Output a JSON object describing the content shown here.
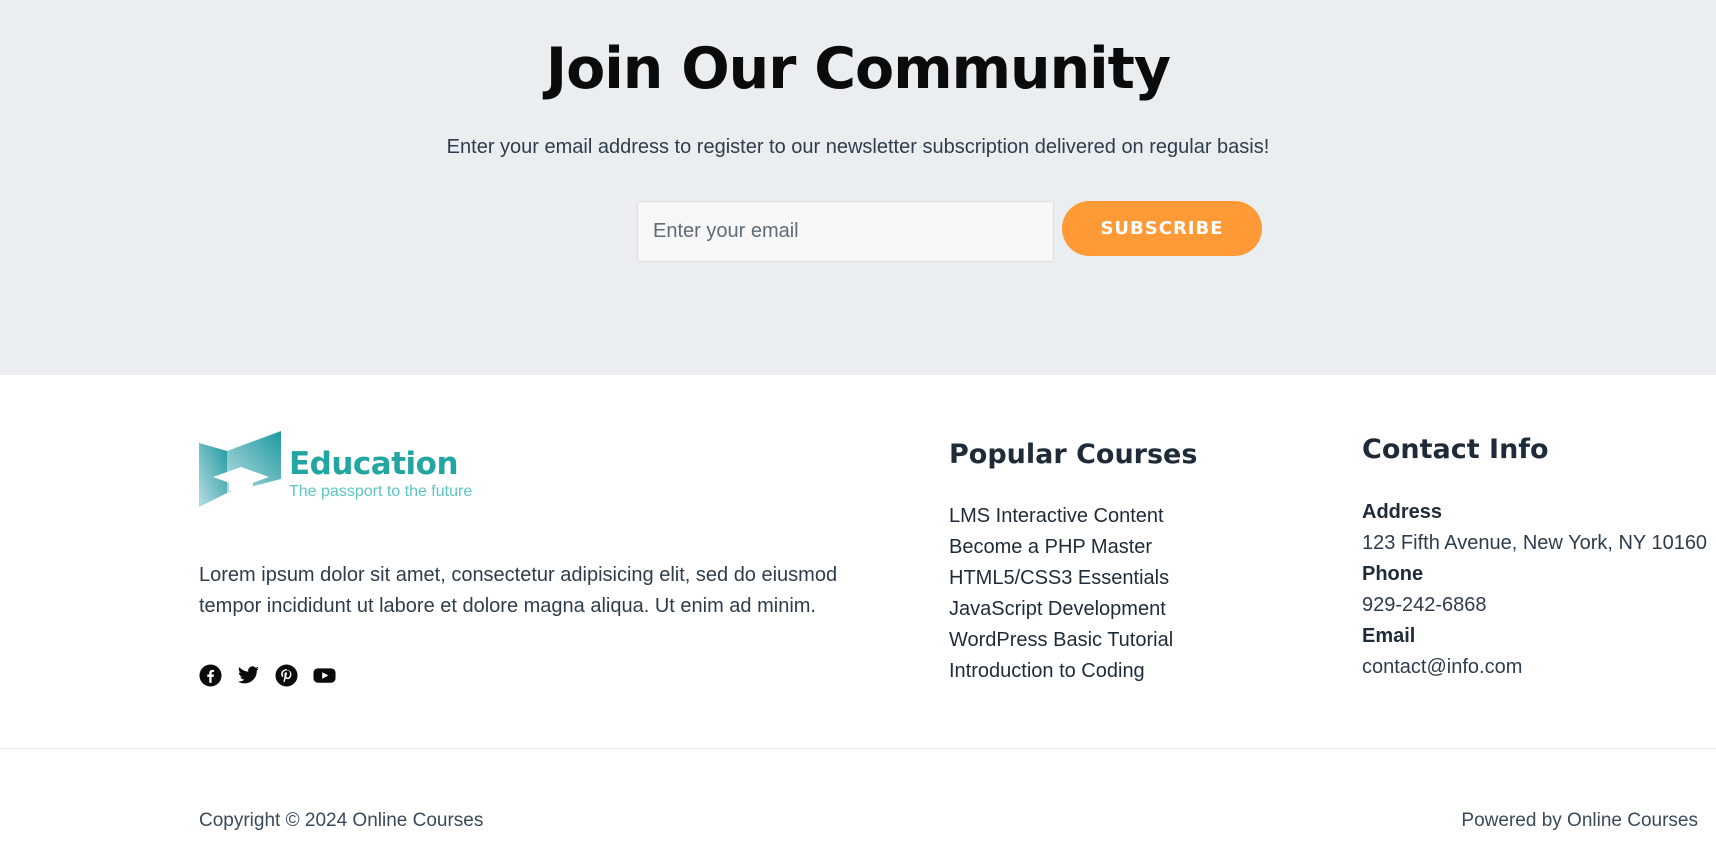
{
  "newsletter": {
    "title": "Join Our Community",
    "subtitle": "Enter your email address to register to our newsletter subscription delivered on regular basis!",
    "email_placeholder": "Enter your email",
    "subscribe_label": "SUBSCRIBE",
    "background_color": "#ebeef1",
    "button_color": "#ff9a36"
  },
  "brand": {
    "name": "Education",
    "tagline": "The passport to the future",
    "color": "#23a5a1"
  },
  "about": {
    "text": "Lorem ipsum dolor sit amet, consectetur adipisicing elit, sed do eiusmod tempor incididunt ut labore et dolore magna aliqua. Ut enim ad minim."
  },
  "socials": [
    {
      "icon": "facebook-icon"
    },
    {
      "icon": "twitter-icon"
    },
    {
      "icon": "pinterest-icon"
    },
    {
      "icon": "youtube-icon"
    }
  ],
  "popular_courses": {
    "title": "Popular Courses",
    "items": [
      "LMS Interactive Content",
      "Become a PHP Master",
      "HTML5/CSS3 Essentials",
      "JavaScript Development",
      "WordPress Basic Tutorial",
      "Introduction to Coding"
    ]
  },
  "contact": {
    "title": "Contact Info",
    "address_label": "Address",
    "address": "123 Fifth Avenue, New York, NY 10160",
    "phone_label": "Phone",
    "phone": "929-242-6868",
    "email_label": "Email",
    "email": "contact@info.com"
  },
  "bottom": {
    "copyright": "Copyright © 2024 Online Courses",
    "powered": "Powered by Online Courses"
  }
}
